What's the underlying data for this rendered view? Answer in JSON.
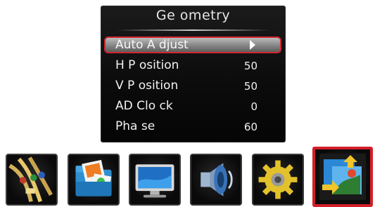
{
  "menu": {
    "title": "Ge ometry",
    "items": [
      {
        "label": "Auto A djust",
        "value": "",
        "selected": true
      },
      {
        "label": "H P osition",
        "value": "50",
        "selected": false
      },
      {
        "label": "V P osition",
        "value": "50",
        "selected": false
      },
      {
        "label": "AD  Clo ck",
        "value": "0",
        "selected": false
      },
      {
        "label": "Pha se",
        "value": "60",
        "selected": false
      }
    ]
  },
  "dock": {
    "items": [
      {
        "icon": "cables-icon",
        "active": false
      },
      {
        "icon": "picture-folder-icon",
        "active": false
      },
      {
        "icon": "monitor-icon",
        "active": false
      },
      {
        "icon": "speaker-icon",
        "active": false
      },
      {
        "icon": "gear-icon",
        "active": false
      },
      {
        "icon": "geometry-position-icon",
        "active": true
      }
    ]
  },
  "colors": {
    "selection_border": "#d2262e",
    "panel_background": "#0f0f0f",
    "active_tab_border": "#d21f2a"
  }
}
